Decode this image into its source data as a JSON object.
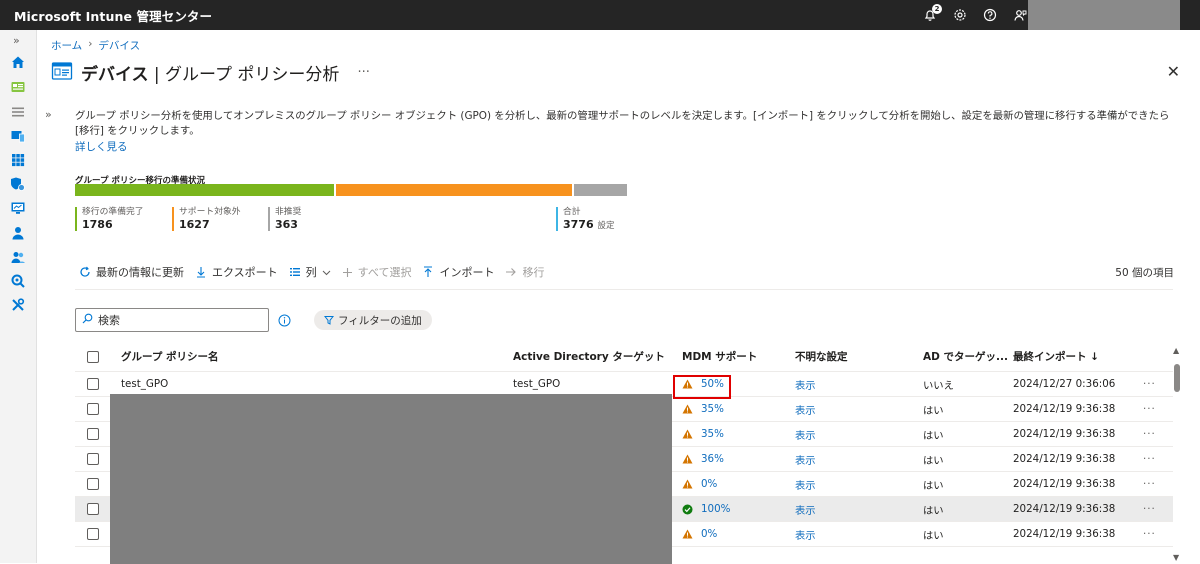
{
  "header": {
    "app_title": "Microsoft Intune 管理センター",
    "notification_count": "2"
  },
  "breadcrumb": [
    "ホーム",
    "デバイス"
  ],
  "page": {
    "title_prefix": "デバイス",
    "title_sep": "|",
    "title_suffix": "グループ ポリシー分析",
    "more": "···",
    "description": "グループ ポリシー分析を使用してオンプレミスのグループ ポリシー オブジェクト (GPO) を分析し、最新の管理サポートのレベルを決定します。[インポート] をクリックして分析を開始し、設定を最新の管理に移行する準備ができたら [移行] をクリックします。",
    "learn_more": "詳しく見る"
  },
  "readiness": {
    "title": "グループ ポリシー移行の準備状況",
    "segments": [
      {
        "label": "移行の準備完了",
        "value": 1786,
        "color": "#7ab51d"
      },
      {
        "label": "サポート対象外",
        "value": 1627,
        "color": "#f7921e"
      },
      {
        "label": "非推奨",
        "value": 363,
        "color": "#a6a6a6"
      }
    ],
    "stats": [
      {
        "label": "移行の準備完了",
        "value": "1786",
        "color": "#7ab51d"
      },
      {
        "label": "サポート対象外",
        "value": "1627",
        "color": "#f7921e"
      },
      {
        "label": "非推奨",
        "value": "363",
        "color": "#a6a6a6"
      }
    ],
    "total_label": "合計",
    "total_value": "3776",
    "total_unit": "設定",
    "total_color": "#3eb5e5"
  },
  "toolbar": {
    "refresh": "最新の情報に更新",
    "export": "エクスポート",
    "columns": "列",
    "select_all": "すべて選択",
    "import": "インポート",
    "migrate": "移行",
    "item_count": "50 個の項目"
  },
  "search": {
    "placeholder": "検索"
  },
  "filter": {
    "label": "フィルターの追加"
  },
  "table": {
    "headers": {
      "name": "グループ ポリシー名",
      "ad_target": "Active Directory ターゲット",
      "mdm": "MDM サポート",
      "unknown": "不明な設定",
      "ad_targeted": "AD でターゲッ...",
      "last_import": "最終インポート ↓"
    },
    "rows": [
      {
        "name": "test_GPO",
        "ad_target": "test_GPO",
        "mdm": "50%",
        "status": "warning",
        "unknown": "表示",
        "ad_targeted": "いいえ",
        "last_import": "2024/12/27 0:36:06"
      },
      {
        "name": "",
        "ad_target": "",
        "mdm": "35%",
        "status": "warning",
        "unknown": "表示",
        "ad_targeted": "はい",
        "last_import": "2024/12/19 9:36:38"
      },
      {
        "name": "",
        "ad_target": "",
        "mdm": "35%",
        "status": "warning",
        "unknown": "表示",
        "ad_targeted": "はい",
        "last_import": "2024/12/19 9:36:38"
      },
      {
        "name": "",
        "ad_target": "",
        "mdm": "36%",
        "status": "warning",
        "unknown": "表示",
        "ad_targeted": "はい",
        "last_import": "2024/12/19 9:36:38"
      },
      {
        "name": "",
        "ad_target": "",
        "mdm": "0%",
        "status": "warning",
        "unknown": "表示",
        "ad_targeted": "はい",
        "last_import": "2024/12/19 9:36:38"
      },
      {
        "name": "",
        "ad_target": "",
        "mdm": "100%",
        "status": "ok",
        "unknown": "表示",
        "ad_targeted": "はい",
        "last_import": "2024/12/19 9:36:38"
      },
      {
        "name": "",
        "ad_target": "",
        "mdm": "0%",
        "status": "warning",
        "unknown": "表示",
        "ad_targeted": "はい",
        "last_import": "2024/12/19 9:36:38"
      }
    ],
    "row_menu": "···"
  }
}
